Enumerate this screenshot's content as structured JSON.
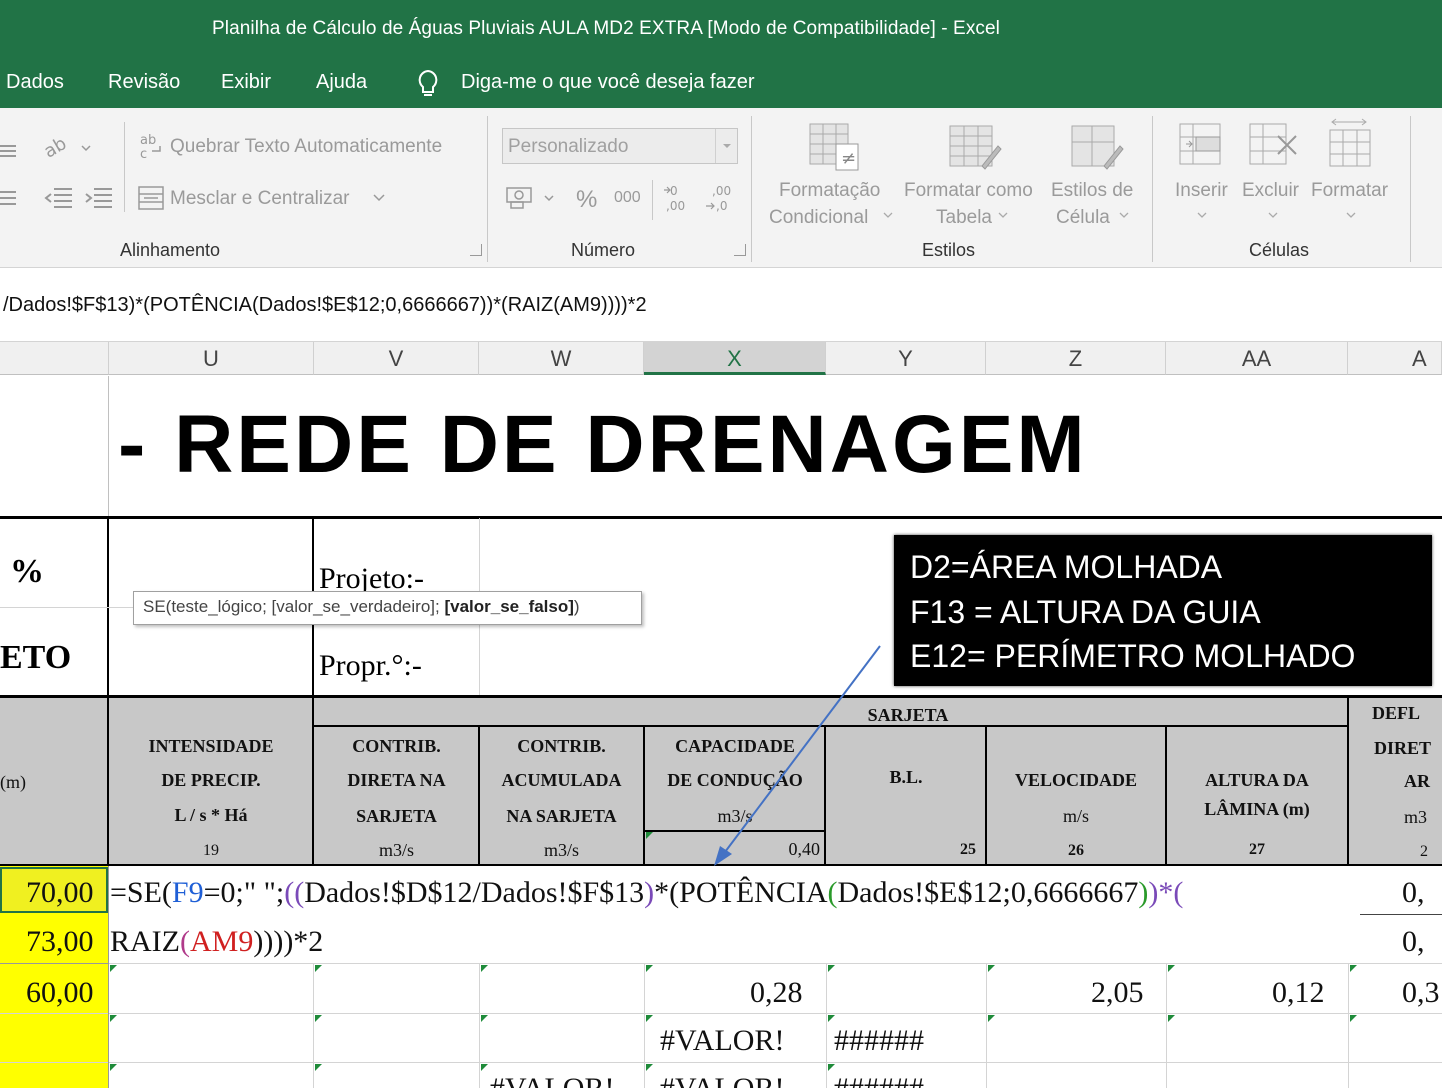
{
  "window": {
    "title": "Planilha de Cálculo de Águas Pluviais AULA MD2 EXTRA  [Modo de Compatibilidade]  -  Excel"
  },
  "menu": {
    "items": [
      "Dados",
      "Revisão",
      "Exibir",
      "Ajuda"
    ],
    "search": "Diga-me o que você deseja fazer"
  },
  "ribbon": {
    "wrap_text": "Quebrar Texto Automaticamente",
    "merge_center": "Mesclar e Centralizar",
    "group_alignment": "Alinhamento",
    "number_format": "Personalizado",
    "percent": "%",
    "thousands": "000",
    "group_number": "Número",
    "cond_format_1": "Formatação",
    "cond_format_2": "Condicional",
    "format_table_1": "Formatar como",
    "format_table_2": "Tabela",
    "cell_styles_1": "Estilos de",
    "cell_styles_2": "Célula",
    "group_styles": "Estilos",
    "insert": "Inserir",
    "delete": "Excluir",
    "format": "Formatar",
    "group_cells": "Células"
  },
  "formula_bar": {
    "text": "/Dados!$F$13)*(POTÊNCIA(Dados!$E$12;0,6666667))*(RAIZ(AM9))))*2"
  },
  "columns": [
    "U",
    "V",
    "W",
    "X",
    "Y",
    "Z",
    "AA",
    "A"
  ],
  "sheet": {
    "title": "- REDE DE DRENAGEM",
    "pct": "%",
    "eto": "ETO",
    "projeto": "Projeto:-",
    "propr": "Propr.°:-",
    "sarjeta": "SARJETA",
    "defl": "DEFL",
    "diret": "DIRET",
    "ar": "AR",
    "m3": "m3",
    "two": "2",
    "m_label": "(m)",
    "intensidade": [
      "INTENSIDADE",
      "DE PRECIP.",
      "L / s * Há"
    ],
    "intensidade_num": "19",
    "contrib_direta": [
      "CONTRIB.",
      "DIRETA NA",
      "SARJETA",
      "m3/s"
    ],
    "contrib_acum": [
      "CONTRIB.",
      "ACUMULADA",
      "NA SARJETA",
      "m3/s"
    ],
    "capacidade": [
      "CAPACIDADE",
      "DE CONDUÇÃO",
      "m3/s"
    ],
    "capacidade_val": "0,40",
    "bl": "B.L.",
    "bl_num": "25",
    "velocidade": [
      "VELOCIDADE",
      "m/s"
    ],
    "velocidade_num": "26",
    "altura": [
      "ALTURA DA",
      "LÂMINA (m)"
    ],
    "altura_num": "27",
    "rows": {
      "r1_a": "70,00",
      "r2_a": "73,00",
      "r3_a": "60,00",
      "r1_b": "0,",
      "r2_b": "0,",
      "r3_b": "0,3",
      "r3_x": "0,28",
      "r3_z": "2,05",
      "r3_aa": "0,12",
      "r4_x": "#VALOR!",
      "r4_y": "######",
      "r5_w": "#VALOR!",
      "r5_x": "#VALOR!",
      "r5_y": "######"
    },
    "formula_1": {
      "p1": "=SE(",
      "p2": "F9",
      "p3": "=0;\" \";",
      "p4": "((",
      "p5": "Dados!$D$12/Dados!$F$13",
      "p6": ")",
      "p7": "*(",
      "p8": "POTÊNCIA",
      "p9": "(",
      "p10": "Dados!$E$12;0,6666667",
      "p11": ")",
      "p12": ")*("
    },
    "formula_2": {
      "p1": "RAIZ",
      "p2": "(",
      "p3": "AM9",
      "p4": "))))*2"
    },
    "tooltip": {
      "plain": "SE(teste_lógico; [valor_se_verdadeiro]; ",
      "bold": "[valor_se_falso]",
      "end": ")"
    }
  },
  "callout": {
    "line1": "D2=ÁREA MOLHADA",
    "line2": "F13 = ALTURA DA GUIA",
    "line3": "E12= PERÍMETRO MOLHADO"
  },
  "colors": {
    "excel_green": "#217346",
    "highlight_yellow": "#ffff00",
    "selected_yellow": "#f0f020",
    "arrow_blue": "#4472c4"
  }
}
